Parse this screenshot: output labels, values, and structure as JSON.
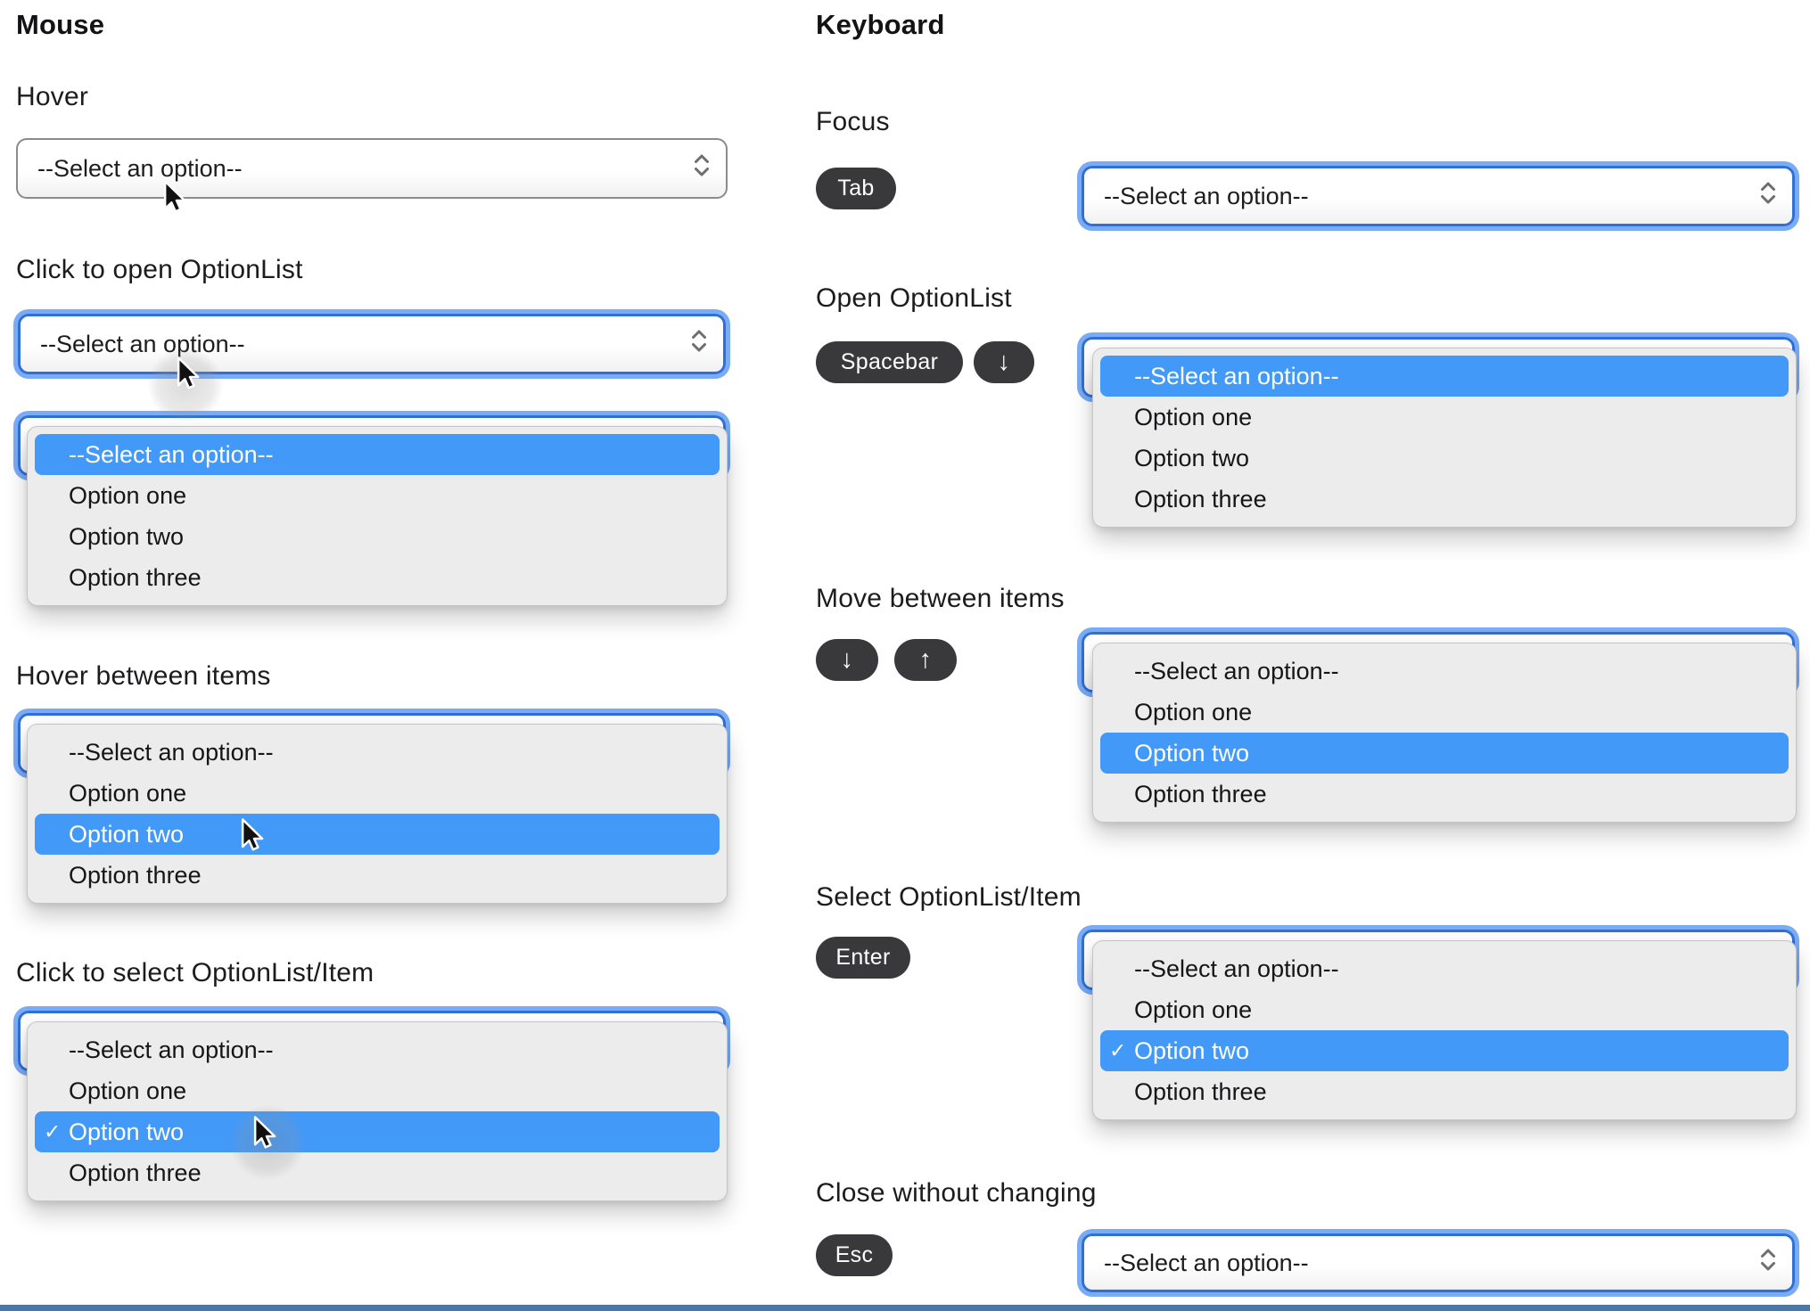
{
  "select": {
    "placeholder": "--Select an option--",
    "options": [
      "--Select an option--",
      "Option one",
      "Option two",
      "Option three"
    ]
  },
  "glyphs": {
    "check": "✓",
    "arrow_down": "↓",
    "arrow_up": "↑"
  },
  "mouse": {
    "title": "Mouse",
    "sections": {
      "hover": "Hover",
      "click_open": "Click to open OptionList",
      "hover_items": "Hover between items",
      "click_select": "Click to select OptionList/Item"
    }
  },
  "keyboard": {
    "title": "Keyboard",
    "sections": {
      "focus": "Focus",
      "open": "Open OptionList",
      "move": "Move between items",
      "select": "Select OptionList/Item",
      "close": "Close without changing"
    },
    "keys": {
      "tab": "Tab",
      "spacebar": "Spacebar",
      "enter": "Enter",
      "esc": "Esc"
    }
  },
  "colors": {
    "focus_ring_outer": "#7aabf5",
    "focus_ring_inner": "#2e6fd8",
    "select_border": "#8a8a8f",
    "select_text": "#1d1d1f",
    "panel_bg": "#ececec",
    "option_highlight": "#4299f8",
    "option_highlight_text": "#ffffff",
    "key_badge_bg": "#39393b",
    "bottom_rule": "#4e76a4"
  }
}
